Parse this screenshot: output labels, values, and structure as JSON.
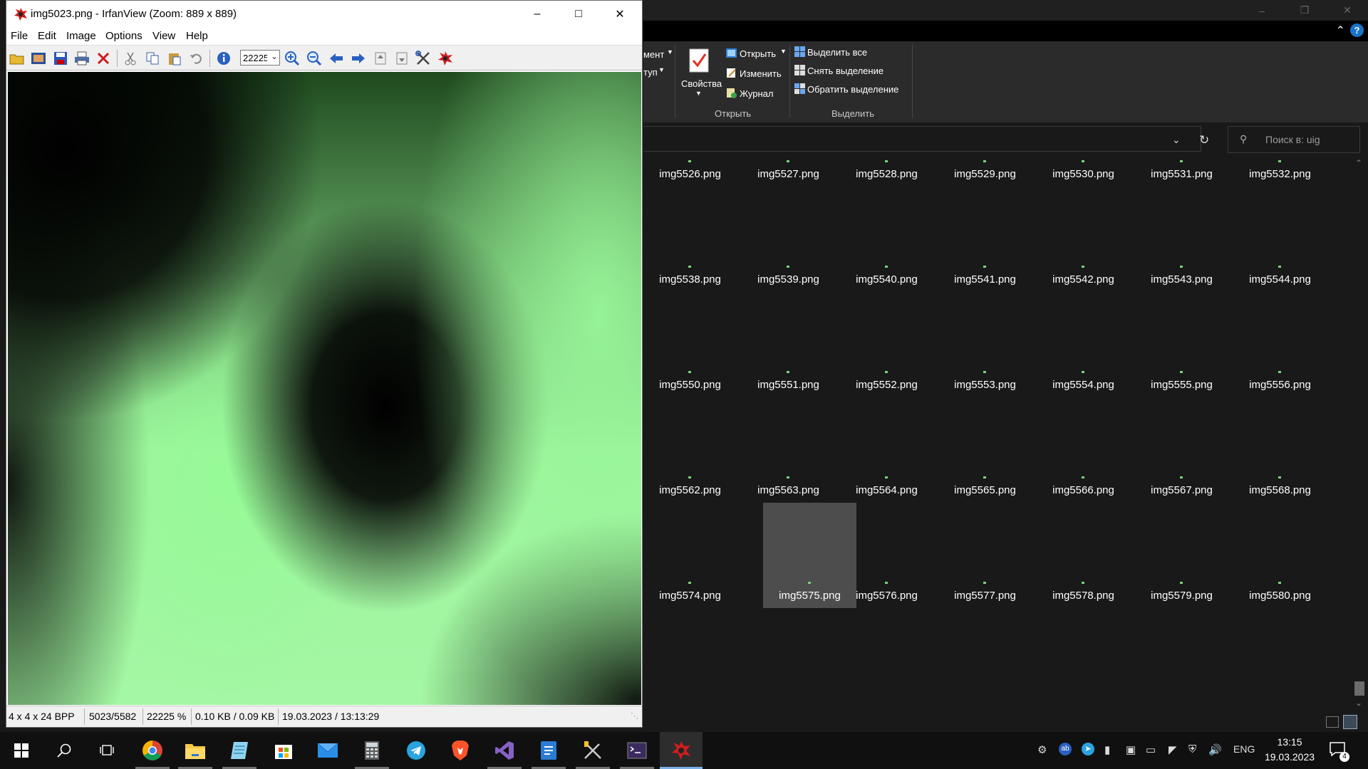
{
  "irfanview": {
    "title": "img5023.png - IrfanView (Zoom: 889 x 889)",
    "menu": [
      "File",
      "Edit",
      "Image",
      "Options",
      "View",
      "Help"
    ],
    "zoom_value": "22225",
    "status": {
      "dimensions": "4 x 4 x 24 BPP",
      "index": "5023/5582",
      "zoom": "22225 %",
      "size": "0.10 KB / 0.09 KB",
      "datetime": "19.03.2023 / 13:13:29"
    }
  },
  "explorer": {
    "ribbon": {
      "partial_item_1": "мент",
      "partial_item_2": "туп",
      "properties": "Свойства",
      "open": "Открыть",
      "edit": "Изменить",
      "history": "Журнал",
      "group_open": "Открыть",
      "select_all": "Выделить все",
      "select_none": "Снять выделение",
      "invert_selection": "Обратить выделение",
      "group_select": "Выделить"
    },
    "search_placeholder": "Поиск в: uig",
    "files": [
      [
        "img5526.png",
        "img5527.png",
        "img5528.png",
        "img5529.png",
        "img5530.png",
        "img5531.png",
        "img5532.png"
      ],
      [
        "img5538.png",
        "img5539.png",
        "img5540.png",
        "img5541.png",
        "img5542.png",
        "img5543.png",
        "img5544.png"
      ],
      [
        "img5550.png",
        "img5551.png",
        "img5552.png",
        "img5553.png",
        "img5554.png",
        "img5555.png",
        "img5556.png"
      ],
      [
        "img5562.png",
        "img5563.png",
        "img5564.png",
        "img5565.png",
        "img5566.png",
        "img5567.png",
        "img5568.png"
      ],
      [
        "img5574.png",
        "img5575.png",
        "img5576.png",
        "img5577.png",
        "img5578.png",
        "img5579.png",
        "img5580.png"
      ]
    ],
    "selected_file": "img5575.png"
  },
  "taskbar": {
    "apps": [
      "start-icon",
      "search-icon",
      "task-view-icon",
      "chrome-icon",
      "file-explorer-icon",
      "notepad-icon",
      "store-icon",
      "mail-icon",
      "calculator-icon",
      "telegram-icon",
      "brave-icon",
      "visual-studio-icon",
      "word-icon",
      "tools-icon",
      "terminal-icon",
      "irfanview-icon"
    ],
    "language": "ENG",
    "time": "13:15",
    "date": "19.03.2023",
    "notification_count": "4"
  }
}
